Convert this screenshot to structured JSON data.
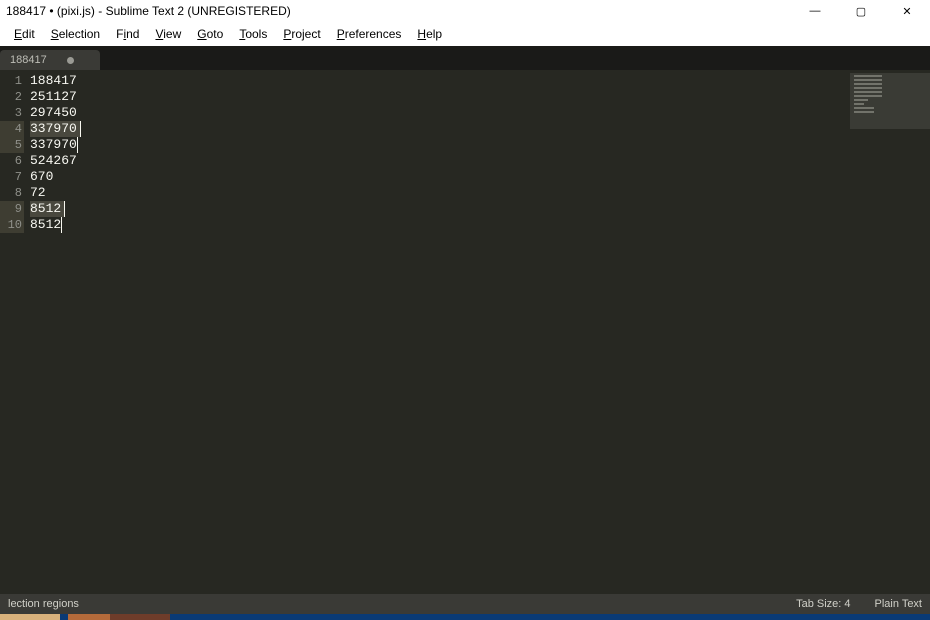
{
  "window": {
    "title": "188417 • (pixi.js) - Sublime Text 2 (UNREGISTERED)"
  },
  "menu": {
    "edit": "Edit",
    "selection": "Selection",
    "find": "Find",
    "view": "View",
    "goto": "Goto",
    "tools": "Tools",
    "project": "Project",
    "preferences": "Preferences",
    "help": "Help"
  },
  "tab": {
    "label": "188417"
  },
  "editor": {
    "lines": [
      {
        "num": "1",
        "text": "188417",
        "selected": false,
        "cursor": false
      },
      {
        "num": "2",
        "text": "251127",
        "selected": false,
        "cursor": false
      },
      {
        "num": "3",
        "text": "297450",
        "selected": false,
        "cursor": false
      },
      {
        "num": "4",
        "text": "337970",
        "selected": true,
        "cursor": false
      },
      {
        "num": "5",
        "text": "337970",
        "selected": false,
        "cursor": true
      },
      {
        "num": "6",
        "text": "524267",
        "selected": false,
        "cursor": false
      },
      {
        "num": "7",
        "text": "670",
        "selected": false,
        "cursor": false
      },
      {
        "num": "8",
        "text": "72",
        "selected": false,
        "cursor": false
      },
      {
        "num": "9",
        "text": "8512",
        "selected": true,
        "cursor": false
      },
      {
        "num": "10",
        "text": "8512",
        "selected": false,
        "cursor": true
      }
    ]
  },
  "status": {
    "left": "lection regions",
    "tab_size": "Tab Size: 4",
    "syntax": "Plain Text"
  },
  "win_controls": {
    "minimize": "—",
    "maximize": "▢",
    "close": "✕"
  }
}
